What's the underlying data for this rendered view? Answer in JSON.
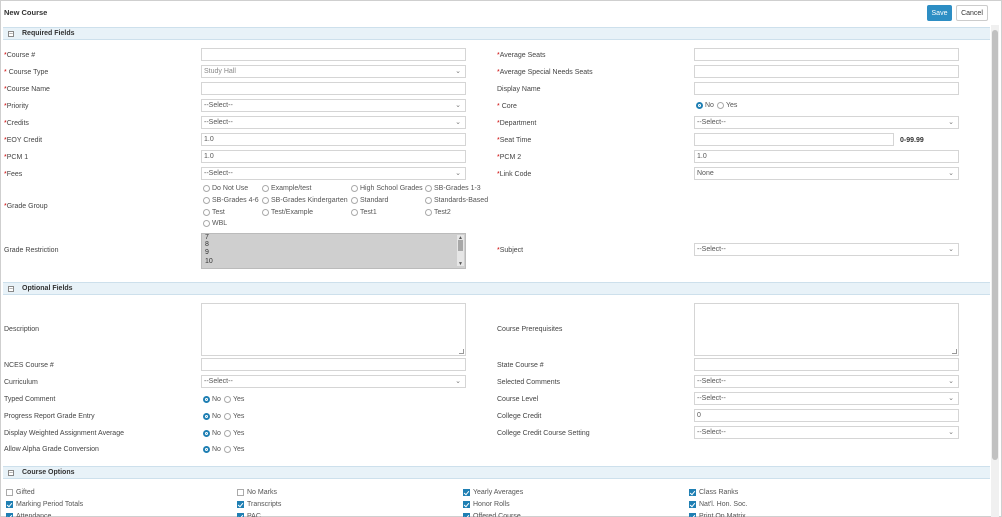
{
  "window": {
    "title": "New Course",
    "save_label": "Save",
    "cancel_label": "Cancel"
  },
  "sections": {
    "required": "Required Fields",
    "optional": "Optional Fields",
    "options": "Course Options"
  },
  "required": {
    "course_num": {
      "label": "Course #",
      "value": ""
    },
    "course_type": {
      "label": "Course Type",
      "value": "Study Hall"
    },
    "course_name": {
      "label": "Course Name",
      "value": ""
    },
    "priority": {
      "label": "Priority",
      "value": "--Select--"
    },
    "credits": {
      "label": "Credits",
      "value": "--Select--"
    },
    "eoy_credit": {
      "label": "EOY Credit",
      "value": "1.0"
    },
    "pcm1": {
      "label": "PCM 1",
      "value": "1.0"
    },
    "fees": {
      "label": "Fees",
      "value": "--Select--"
    },
    "grade_group": {
      "label": "Grade Group",
      "options": [
        "Do Not Use",
        "Example/test",
        "High School Grades",
        "SB-Grades 1-3",
        "SB-Grades 4-6",
        "SB-Grades Kindergarten",
        "Standard",
        "Standards-Based",
        "Test",
        "Test/Example",
        "Test1",
        "Test2",
        "WBL"
      ]
    },
    "grade_restriction": {
      "label": "Grade Restriction",
      "options": [
        "7",
        "8",
        "9",
        "10"
      ]
    },
    "avg_seats": {
      "label": "Average Seats",
      "value": ""
    },
    "avg_special": {
      "label": "Average Special Needs Seats",
      "value": ""
    },
    "display_name": {
      "label": "Display Name",
      "value": ""
    },
    "core": {
      "label": "Core",
      "no": "No",
      "yes": "Yes"
    },
    "department": {
      "label": "Department",
      "value": "--Select--"
    },
    "seat_time": {
      "label": "Seat Time",
      "hint": "0-99.99"
    },
    "pcm2": {
      "label": "PCM 2",
      "value": "1.0"
    },
    "link_code": {
      "label": "Link Code",
      "value": "None"
    },
    "subject": {
      "label": "Subject",
      "value": "--Select--"
    }
  },
  "optional": {
    "description": "Description",
    "prerequisites": "Course Prerequisites",
    "nces": "NCES Course #",
    "state_course": "State Course #",
    "curriculum": {
      "label": "Curriculum",
      "value": "--Select--"
    },
    "selected_comments": {
      "label": "Selected Comments",
      "value": "--Select--"
    },
    "typed_comment": "Typed Comment",
    "course_level": {
      "label": "Course Level",
      "value": "--Select--"
    },
    "progress_report": "Progress Report Grade Entry",
    "college_credit": {
      "label": "College Credit",
      "value": "0"
    },
    "weighted_avg": "Display Weighted Assignment Average",
    "college_setting": {
      "label": "College Credit Course Setting",
      "value": "--Select--"
    },
    "alpha_grade": "Allow Alpha Grade Conversion",
    "no": "No",
    "yes": "Yes"
  },
  "options": {
    "items": [
      {
        "label": "Gifted",
        "checked": false
      },
      {
        "label": "No Marks",
        "checked": false
      },
      {
        "label": "Yearly Averages",
        "checked": true
      },
      {
        "label": "Class Ranks",
        "checked": true
      },
      {
        "label": "Marking Period Totals",
        "checked": true
      },
      {
        "label": "Transcripts",
        "checked": true
      },
      {
        "label": "Honor Rolls",
        "checked": true
      },
      {
        "label": "Nat'l. Hon. Soc.",
        "checked": true
      },
      {
        "label": "Attendance",
        "checked": true
      },
      {
        "label": "PAC",
        "checked": true
      },
      {
        "label": "Offered Course",
        "checked": true
      },
      {
        "label": "Print On Matrix",
        "checked": true
      }
    ]
  }
}
